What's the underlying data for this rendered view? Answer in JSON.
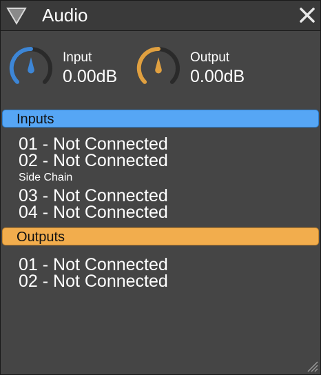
{
  "window": {
    "title": "Audio",
    "icons": {
      "collapse": "triangle-down-icon",
      "close": "close-x-icon",
      "resize": "resize-grip-icon"
    }
  },
  "meters": {
    "input": {
      "label": "Input",
      "value": "0.00dB",
      "color": "#3d86d6"
    },
    "output": {
      "label": "Output",
      "value": "0.00dB",
      "color": "#e0a040"
    }
  },
  "inputs": {
    "header": "Inputs",
    "color": "#56a6f5",
    "channels": [
      "01 - Not Connected",
      "02 - Not Connected"
    ],
    "side_chain_label": "Side Chain",
    "side_chain_channels": [
      "03 - Not Connected",
      "04 - Not Connected"
    ]
  },
  "outputs": {
    "header": "Outputs",
    "color": "#f2ad4d",
    "channels": [
      "01 - Not Connected",
      "02 - Not Connected"
    ]
  }
}
